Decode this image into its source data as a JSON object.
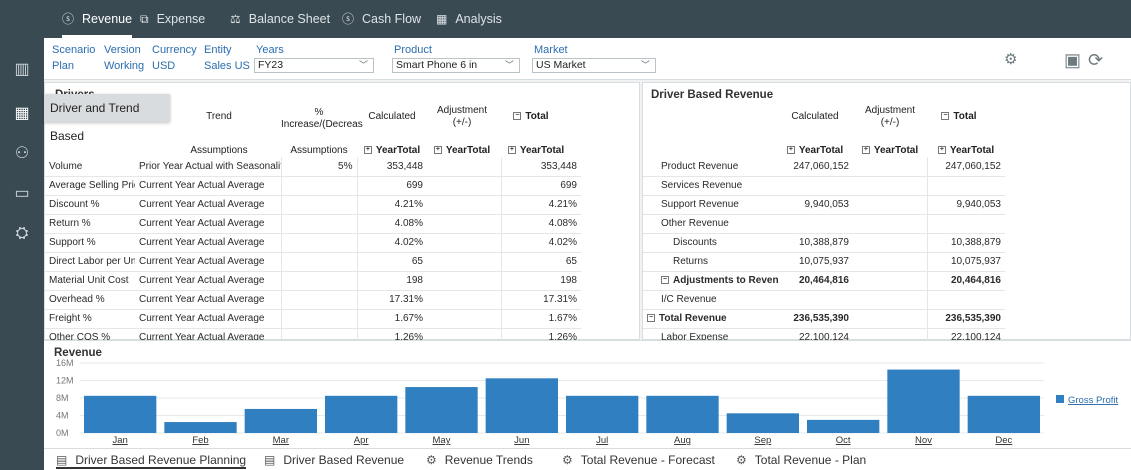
{
  "top_tabs": [
    {
      "icon": "dollar-circle-icon",
      "glyph": "$",
      "label": "Revenue",
      "active": true
    },
    {
      "icon": "expense-icon",
      "glyph": "↗",
      "label": "Expense",
      "active": false
    },
    {
      "icon": "balance-sheet-icon",
      "glyph": "⚖",
      "label": "Balance Sheet",
      "active": false
    },
    {
      "icon": "dollar-circle-icon",
      "glyph": "$",
      "label": "Cash Flow",
      "active": false
    },
    {
      "icon": "analysis-icon",
      "glyph": "▦",
      "label": "Analysis",
      "active": false
    }
  ],
  "pov": {
    "scenario_label": "Scenario",
    "scenario_value": "Plan",
    "version_label": "Version",
    "version_value": "Working",
    "currency_label": "Currency",
    "currency_value": "USD",
    "entity_label": "Entity",
    "entity_value": "Sales US",
    "years_label": "Years",
    "years_value": "FY23",
    "product_label": "Product",
    "product_value": "Smart Phone 6 in",
    "market_label": "Market",
    "market_value": "US Market"
  },
  "tooltip": "Driver and Trend Based",
  "drivers": {
    "title": "Drivers",
    "col_trend": "Trend",
    "col_pct": "%",
    "col_pct2": "Increase/(Decreas",
    "col_calc": "Calculated",
    "col_adj": "Adjustment",
    "col_adj2": "(+/-)",
    "col_total": "Total",
    "sub_assumptions": "Assumptions",
    "sub_assumptions2": "Assumptions",
    "sub_yt1": "YearTotal",
    "sub_yt2": "YearTotal",
    "sub_yt3": "YearTotal",
    "rows": [
      {
        "name": "Volume",
        "trend": "Prior Year Actual with Seasonality",
        "pct": "5%",
        "calc": "353,448",
        "adj": "",
        "total": "353,448"
      },
      {
        "name": "Average Selling Price",
        "trend": "Current Year Actual Average",
        "pct": "",
        "calc": "699",
        "adj": "",
        "total": "699"
      },
      {
        "name": "Discount %",
        "trend": "Current Year Actual Average",
        "pct": "",
        "calc": "4.21%",
        "adj": "",
        "total": "4.21%"
      },
      {
        "name": "Return %",
        "trend": "Current Year Actual Average",
        "pct": "",
        "calc": "4.08%",
        "adj": "",
        "total": "4.08%"
      },
      {
        "name": "Support %",
        "trend": "Current Year Actual Average",
        "pct": "",
        "calc": "4.02%",
        "adj": "",
        "total": "4.02%"
      },
      {
        "name": "Direct Labor per Unit",
        "trend": "Current Year Actual Average",
        "pct": "",
        "calc": "65",
        "adj": "",
        "total": "65"
      },
      {
        "name": "Material Unit Cost",
        "trend": "Current Year Actual Average",
        "pct": "",
        "calc": "198",
        "adj": "",
        "total": "198"
      },
      {
        "name": "Overhead %",
        "trend": "Current Year Actual Average",
        "pct": "",
        "calc": "17.31%",
        "adj": "",
        "total": "17.31%"
      },
      {
        "name": "Freight %",
        "trend": "Current Year Actual Average",
        "pct": "",
        "calc": "1.67%",
        "adj": "",
        "total": "1.67%"
      },
      {
        "name": "Other COS %",
        "trend": "Current Year Actual Average",
        "pct": "",
        "calc": "1.26%",
        "adj": "",
        "total": "1.26%"
      }
    ]
  },
  "dbr": {
    "title": "Driver Based Revenue",
    "col_calc": "Calculated",
    "col_adj": "Adjustment",
    "col_adj2": "(+/-)",
    "col_total": "Total",
    "sub_yt1": "YearTotal",
    "sub_yt2": "YearTotal",
    "sub_yt3": "YearTotal",
    "rows": [
      {
        "name": "Product Revenue",
        "calc": "247,060,152",
        "adj": "",
        "total": "247,060,152",
        "bold": false,
        "collapse": false
      },
      {
        "name": "Services Revenue",
        "calc": "",
        "adj": "",
        "total": "",
        "bold": false,
        "collapse": false
      },
      {
        "name": "Support Revenue",
        "calc": "9,940,053",
        "adj": "",
        "total": "9,940,053",
        "bold": false,
        "collapse": false
      },
      {
        "name": "Other Revenue",
        "calc": "",
        "adj": "",
        "total": "",
        "bold": false,
        "collapse": false
      },
      {
        "name": "Discounts",
        "calc": "10,388,879",
        "adj": "",
        "total": "10,388,879",
        "bold": false,
        "collapse": false
      },
      {
        "name": "Returns",
        "calc": "10,075,937",
        "adj": "",
        "total": "10,075,937",
        "bold": false,
        "collapse": false
      },
      {
        "name": "Adjustments to Revenu",
        "calc": "20,464,816",
        "adj": "",
        "total": "20,464,816",
        "bold": true,
        "collapse": true
      },
      {
        "name": "I/C Revenue",
        "calc": "",
        "adj": "",
        "total": "",
        "bold": false,
        "collapse": false
      },
      {
        "name": "Total Revenue",
        "calc": "236,535,390",
        "adj": "",
        "total": "236,535,390",
        "bold": true,
        "collapse": true
      },
      {
        "name": "Labor Expense",
        "calc": "22,100,124",
        "adj": "",
        "total": "22,100,124",
        "bold": false,
        "collapse": false
      }
    ]
  },
  "chart_data": {
    "type": "bar",
    "title": "Revenue",
    "categories": [
      "Jan",
      "Feb",
      "Mar",
      "Apr",
      "May",
      "Jun",
      "Jul",
      "Aug",
      "Sep",
      "Oct",
      "Nov",
      "Dec"
    ],
    "series": [
      {
        "name": "Gross Profit",
        "values": [
          8.5,
          2.5,
          5.5,
          8.5,
          10.5,
          12.5,
          8.5,
          8.5,
          4.5,
          3.0,
          14.5,
          8.5
        ]
      }
    ],
    "yticks": [
      "16M",
      "12M",
      "8M",
      "4M",
      "0M"
    ],
    "ylim": [
      0,
      16
    ],
    "bar_color": "#2f7fc1",
    "legend_position": "right"
  },
  "bottom_tabs": [
    {
      "icon": "form-icon",
      "glyph": "▤",
      "label": "Driver Based Revenue Planning",
      "active": true
    },
    {
      "icon": "form-icon",
      "glyph": "▤",
      "label": "Driver Based Revenue",
      "active": false
    },
    {
      "icon": "chart-icon",
      "glyph": "⚙",
      "label": "Revenue Trends",
      "active": false
    },
    {
      "icon": "chart-icon",
      "glyph": "⚙",
      "label": "Total Revenue - Forecast",
      "active": false
    },
    {
      "icon": "chart-icon",
      "glyph": "⚙",
      "label": "Total Revenue - Plan",
      "active": false
    }
  ]
}
